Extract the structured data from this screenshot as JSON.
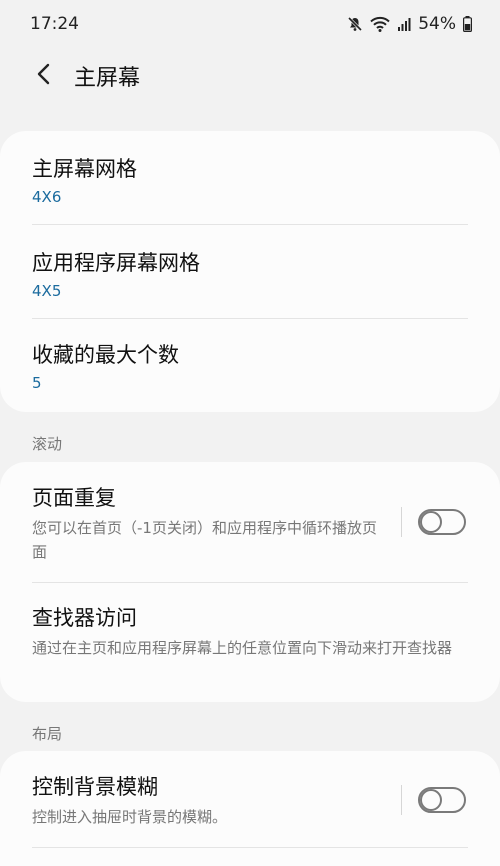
{
  "status_bar": {
    "time": "17:24",
    "battery_percent": "54%",
    "icons": [
      "mute-icon",
      "wifi-icon",
      "signal-icon",
      "battery-icon"
    ]
  },
  "header": {
    "title": "主屏幕",
    "back_icon": "chevron-left-icon"
  },
  "main_card": {
    "items": [
      {
        "title": "主屏幕网格",
        "value": "4X6"
      },
      {
        "title": "应用程序屏幕网格",
        "value": "4X5"
      },
      {
        "title": "收藏的最大个数",
        "value": "5"
      }
    ]
  },
  "scroll_section": {
    "header": "滚动",
    "items": [
      {
        "title": "页面重复",
        "description": "您可以在首页（-1页关闭）和应用程序中循环播放页面",
        "toggle_on": false
      },
      {
        "title": "查找器访问",
        "description": "通过在主页和应用程序屏幕上的任意位置向下滑动来打开查找器"
      }
    ]
  },
  "layout_section": {
    "header": "布局",
    "items": [
      {
        "title": "控制背景模糊",
        "description": "控制进入抽屉时背景的模糊。",
        "toggle_on": false
      }
    ]
  },
  "colors": {
    "value_text": "#1b6b9e",
    "background": "#f2f2f2",
    "card": "#fcfcfc"
  }
}
